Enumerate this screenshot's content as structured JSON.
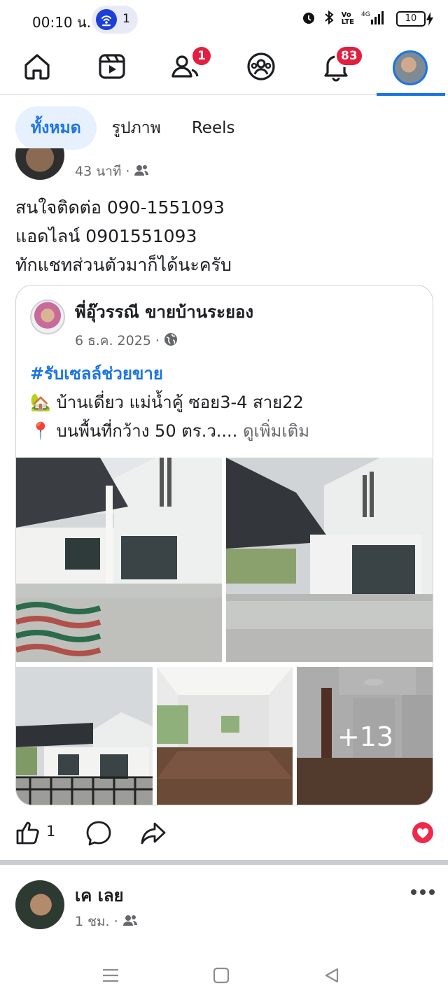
{
  "status_bar": {
    "time": "00:10 น.",
    "hotspot_count": "1",
    "battery": "10"
  },
  "nav": {
    "items": [
      {
        "icon": "home-icon"
      },
      {
        "icon": "video-icon"
      },
      {
        "icon": "friends-icon",
        "badge": "1"
      },
      {
        "icon": "groups-icon"
      },
      {
        "icon": "bell-icon",
        "badge": "83"
      },
      {
        "icon": "profile-avatar"
      }
    ],
    "accent": "#1b74e4",
    "badge_color": "#e41e3f"
  },
  "tabs": [
    {
      "label": "ทั้งหมด",
      "active": true
    },
    {
      "label": "รูปภาพ",
      "active": false
    },
    {
      "label": "Reels",
      "active": false
    }
  ],
  "post1": {
    "time": "43 นาที",
    "lines": [
      "สนใจติดต่อ 090-1551093",
      "แอดไลน์ 0901551093",
      "ทักแชทส่วนตัวมาก็ได้นะครับ"
    ],
    "shared": {
      "author": "พี่อุ๊วรรณี ขายบ้านระยอง",
      "date": "6 ธ.ค. 2025",
      "hashtag": "#รับเซลล์ช่วยขาย",
      "line1_emoji": "🏡",
      "line1": "บ้านเดี่ยว แม่น้ำคู้ ซอย3-4 สาย22",
      "line2_emoji": "📍",
      "line2": "บนพื้นที่กว้าง 50 ตร.ว....",
      "see_more": "ดูเพิ่มเติม",
      "more_photos": "+13"
    },
    "like_count": "1"
  },
  "post2": {
    "author": "เค เลย",
    "time": "1 ชม."
  }
}
